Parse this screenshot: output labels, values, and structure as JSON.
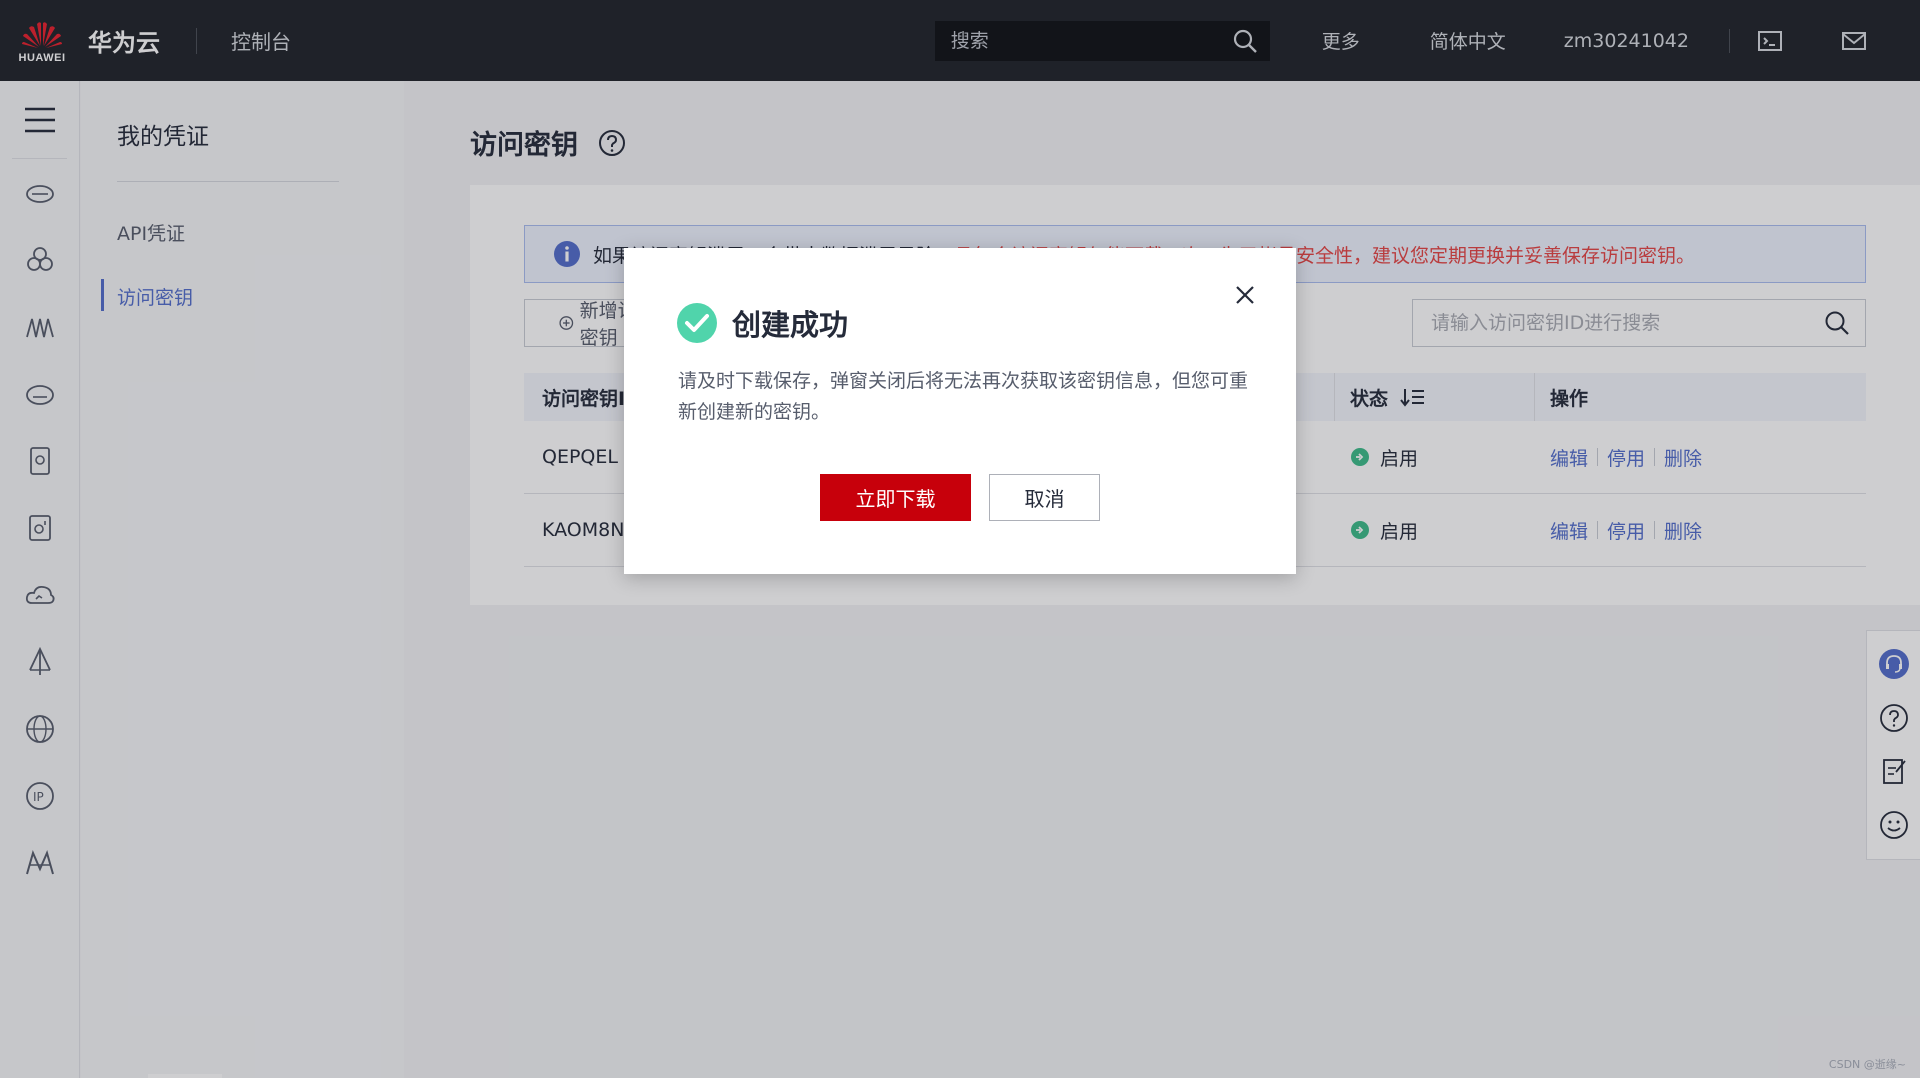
{
  "topbar": {
    "logo_text": "HUAWEI",
    "brand": "华为云",
    "console": "控制台",
    "search_placeholder": "搜索",
    "more": "更多",
    "language": "简体中文",
    "username": "zm30241042",
    "icons": [
      "terminal-icon",
      "mail-icon"
    ]
  },
  "rail": {
    "icons": [
      "menu-icon",
      "cloud-server-icon",
      "cluster-icon",
      "network-icon",
      "storage-icon",
      "disk-icon",
      "backup-icon",
      "cloud-monitor-icon",
      "load-balance-icon",
      "global-network-icon",
      "eip-icon",
      "model-arts-icon"
    ]
  },
  "subnav": {
    "title": "我的凭证",
    "items": [
      {
        "label": "API凭证",
        "active": false
      },
      {
        "label": "访问密钥",
        "active": true
      }
    ]
  },
  "main": {
    "title": "访问密钥",
    "notice": {
      "text_normal": "如果访问密钥泄露，会带来数据泄露风险",
      "text_warning": "，且每个访问密钥仅能下载一次，为了帐号安全性，建议您定期更换并妥善保存访问密钥。"
    },
    "add_button": "新增访问密钥",
    "search_placeholder": "请输入访问密钥ID进行搜索",
    "table": {
      "headers": [
        "访问密钥ID",
        "状态",
        "操作"
      ],
      "rows": [
        {
          "id": "QEPQEL",
          "status": "启用",
          "ops": [
            "编辑",
            "停用",
            "删除"
          ]
        },
        {
          "id": "KAOM8N",
          "status": "启用",
          "ops": [
            "编辑",
            "停用",
            "删除"
          ]
        }
      ]
    }
  },
  "dialog": {
    "title": "创建成功",
    "body": "请及时下载保存，弹窗关闭后将无法再次获取该密钥信息，但您可重新创建新的密钥。",
    "primary": "立即下载",
    "cancel": "取消"
  },
  "floatbar": {
    "icons": [
      "customer-service-icon",
      "help-icon",
      "feedback-icon",
      "satisfaction-icon"
    ]
  },
  "watermark": "CSDN @逝缘~",
  "colors": {
    "brand_red": "#c7000b",
    "link_blue": "#526ecc",
    "success_green": "#50d4ab",
    "warning_red": "#e54545"
  }
}
